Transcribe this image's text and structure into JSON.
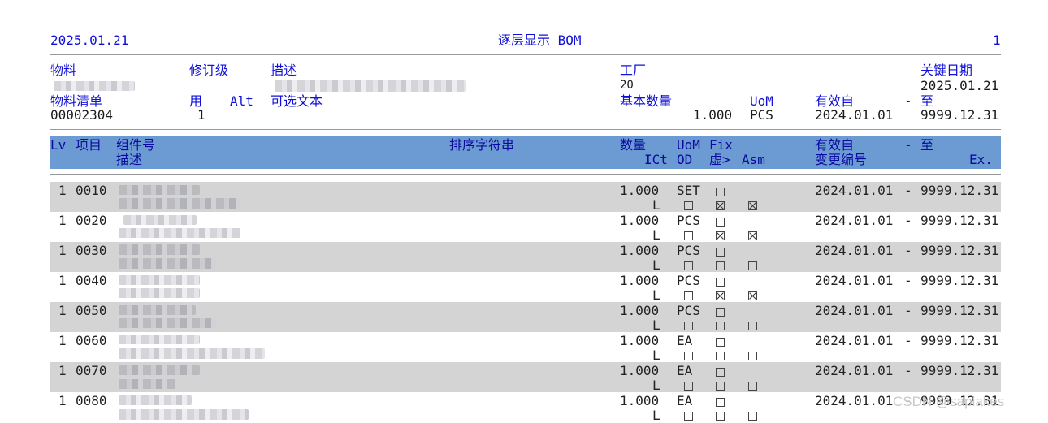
{
  "report": {
    "date": "2025.01.21",
    "title": "逐层显示 BOM",
    "page": "1"
  },
  "header": {
    "material_label": "物料",
    "revision_label": "修订级",
    "description_label": "描述",
    "plant_label": "工厂",
    "plant_value": "20",
    "key_date_label": "关键日期",
    "key_date_value": "2025.01.21",
    "bom_label": "物料清单",
    "bom_value": "00002304",
    "usage_label": "用",
    "usage_value": "1",
    "alt_label": "Alt",
    "alt_text_label": "可选文本",
    "base_qty_label": "基本数量",
    "base_qty_value": "1.000",
    "uom_label": "UoM",
    "uom_value": "PCS",
    "valid_from_label": "有效自",
    "valid_from_value": "2024.01.01",
    "dash": "-",
    "to_label": "至",
    "valid_to_value": "9999.12.31"
  },
  "columns": {
    "lv": "Lv",
    "item": "项目",
    "component": "组件号",
    "description": "描述",
    "sort_string": "排序字符串",
    "qty": "数量",
    "ict": "ICt",
    "uom": "UoM",
    "od": "OD",
    "fix": "Fix",
    "phantom": "虚>",
    "asm": "Asm",
    "valid_from": "有效自",
    "change_no": "变更编号",
    "dash": "-",
    "to": "至",
    "ex": "Ex."
  },
  "rows": [
    {
      "lv": "1",
      "item": "0010",
      "qty": "1.000",
      "ict": "L",
      "uom": "SET",
      "fix": false,
      "od": false,
      "phantom": true,
      "asm": true,
      "from": "2024.01.01",
      "dash": "-",
      "to": "9999.12.31"
    },
    {
      "lv": "1",
      "item": "0020",
      "qty": "1.000",
      "ict": "L",
      "uom": "PCS",
      "fix": false,
      "od": false,
      "phantom": true,
      "asm": true,
      "from": "2024.01.01",
      "dash": "-",
      "to": "9999.12.31"
    },
    {
      "lv": "1",
      "item": "0030",
      "qty": "1.000",
      "ict": "L",
      "uom": "PCS",
      "fix": false,
      "od": false,
      "phantom": false,
      "asm": false,
      "from": "2024.01.01",
      "dash": "-",
      "to": "9999.12.31"
    },
    {
      "lv": "1",
      "item": "0040",
      "qty": "1.000",
      "ict": "L",
      "uom": "PCS",
      "fix": false,
      "od": false,
      "phantom": true,
      "asm": true,
      "from": "2024.01.01",
      "dash": "-",
      "to": "9999.12.31"
    },
    {
      "lv": "1",
      "item": "0050",
      "qty": "1.000",
      "ict": "L",
      "uom": "PCS",
      "fix": false,
      "od": false,
      "phantom": false,
      "asm": false,
      "from": "2024.01.01",
      "dash": "-",
      "to": "9999.12.31"
    },
    {
      "lv": "1",
      "item": "0060",
      "qty": "1.000",
      "ict": "L",
      "uom": "EA",
      "fix": false,
      "od": false,
      "phantom": false,
      "asm": false,
      "from": "2024.01.01",
      "dash": "-",
      "to": "9999.12.31"
    },
    {
      "lv": "1",
      "item": "0070",
      "qty": "1.000",
      "ict": "L",
      "uom": "EA",
      "fix": false,
      "od": false,
      "phantom": false,
      "asm": false,
      "from": "2024.01.01",
      "dash": "-",
      "to": "9999.12.31"
    },
    {
      "lv": "1",
      "item": "0080",
      "qty": "1.000",
      "ict": "L",
      "uom": "EA",
      "fix": false,
      "od": false,
      "phantom": false,
      "asm": false,
      "from": "2024.01.01",
      "dash": "-",
      "to": "9999.12.31"
    }
  ],
  "watermark": "CSDN @saplakes",
  "colors": {
    "header_text": "#1010d8",
    "column_header_bg": "#6b9bd2",
    "row_shade": "#d4d4d4"
  }
}
